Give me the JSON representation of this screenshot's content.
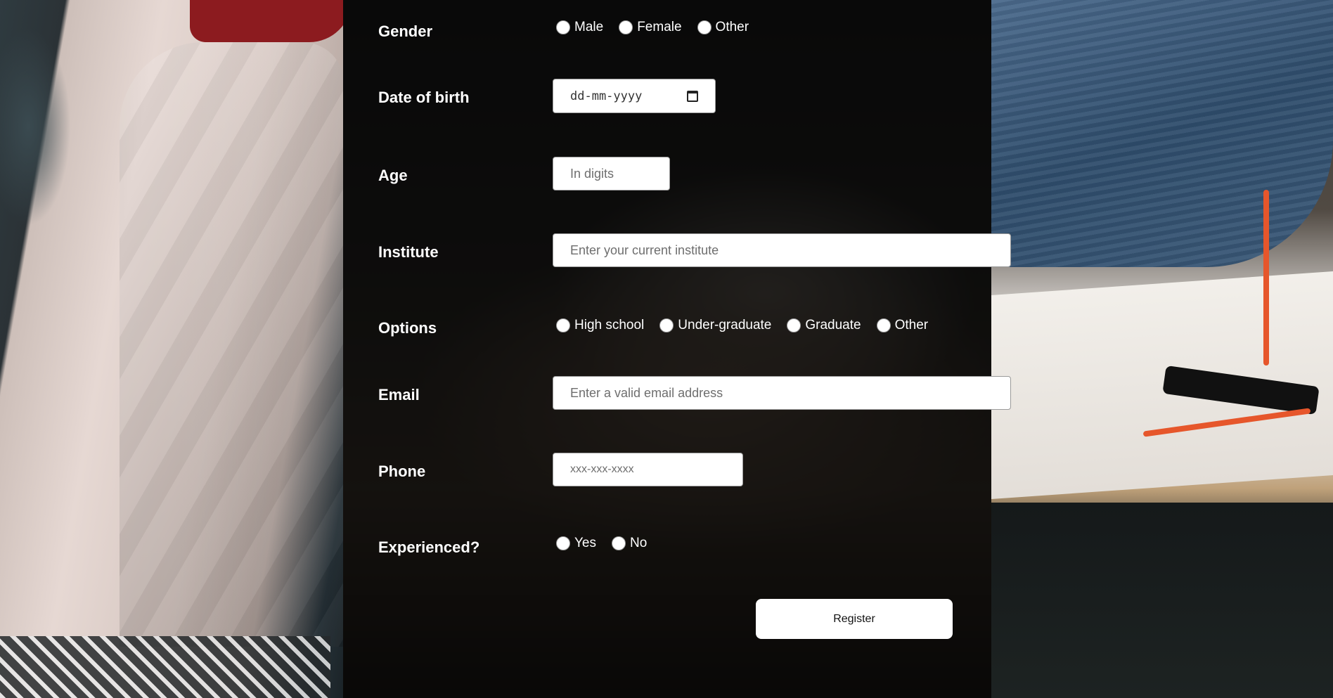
{
  "form": {
    "gender": {
      "label": "Gender",
      "options": [
        "Male",
        "Female",
        "Other"
      ]
    },
    "dob": {
      "label": "Date of birth",
      "placeholder": "dd-mm-yyyy"
    },
    "age": {
      "label": "Age",
      "placeholder": "In digits"
    },
    "institute": {
      "label": "Institute",
      "placeholder": "Enter your current institute"
    },
    "options": {
      "label": "Options",
      "choices": [
        "High school",
        "Under-graduate",
        "Graduate",
        "Other"
      ]
    },
    "email": {
      "label": "Email",
      "placeholder": "Enter a valid email address"
    },
    "phone": {
      "label": "Phone",
      "placeholder": "xxx-xxx-xxxx"
    },
    "experienced": {
      "label": "Experienced?",
      "options": [
        "Yes",
        "No"
      ]
    },
    "submit_label": "Register"
  },
  "icons": {
    "date_picker": "calendar-icon"
  }
}
